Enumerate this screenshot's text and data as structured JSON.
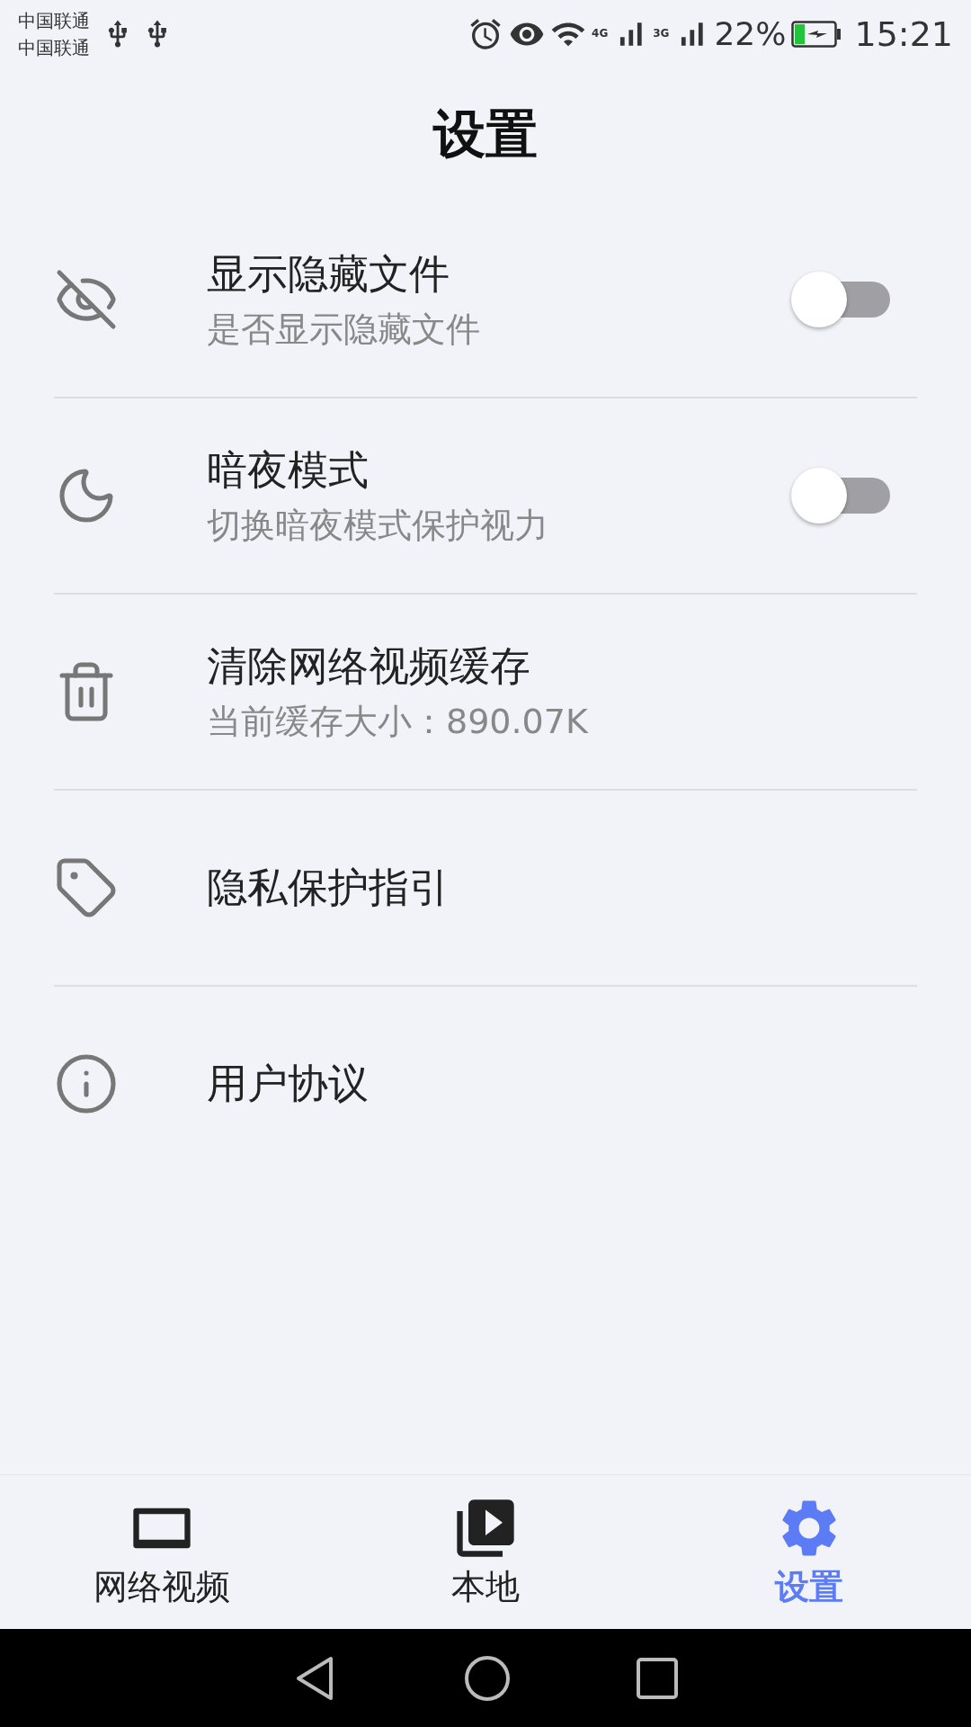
{
  "status_bar": {
    "carriers": [
      "中国联通",
      "中国联通"
    ],
    "network_4g": "4G",
    "network_3g": "3G",
    "battery": "22%",
    "time": "15:21"
  },
  "title": "设置",
  "settings": [
    {
      "kind": "toggle",
      "title": "显示隐藏文件",
      "subtitle": "是否显示隐藏文件",
      "on": false
    },
    {
      "kind": "toggle",
      "title": "暗夜模式",
      "subtitle": "切换暗夜模式保护视力",
      "on": false
    },
    {
      "kind": "plain",
      "title": "清除网络视频缓存",
      "subtitle": "当前缓存大小：890.07K"
    },
    {
      "kind": "plain",
      "title": "隐私保护指引"
    },
    {
      "kind": "plain",
      "title": "用户协议"
    }
  ],
  "tabs": [
    {
      "label": "网络视频",
      "selected": false
    },
    {
      "label": "本地",
      "selected": false
    },
    {
      "label": "设置",
      "selected": true
    }
  ]
}
